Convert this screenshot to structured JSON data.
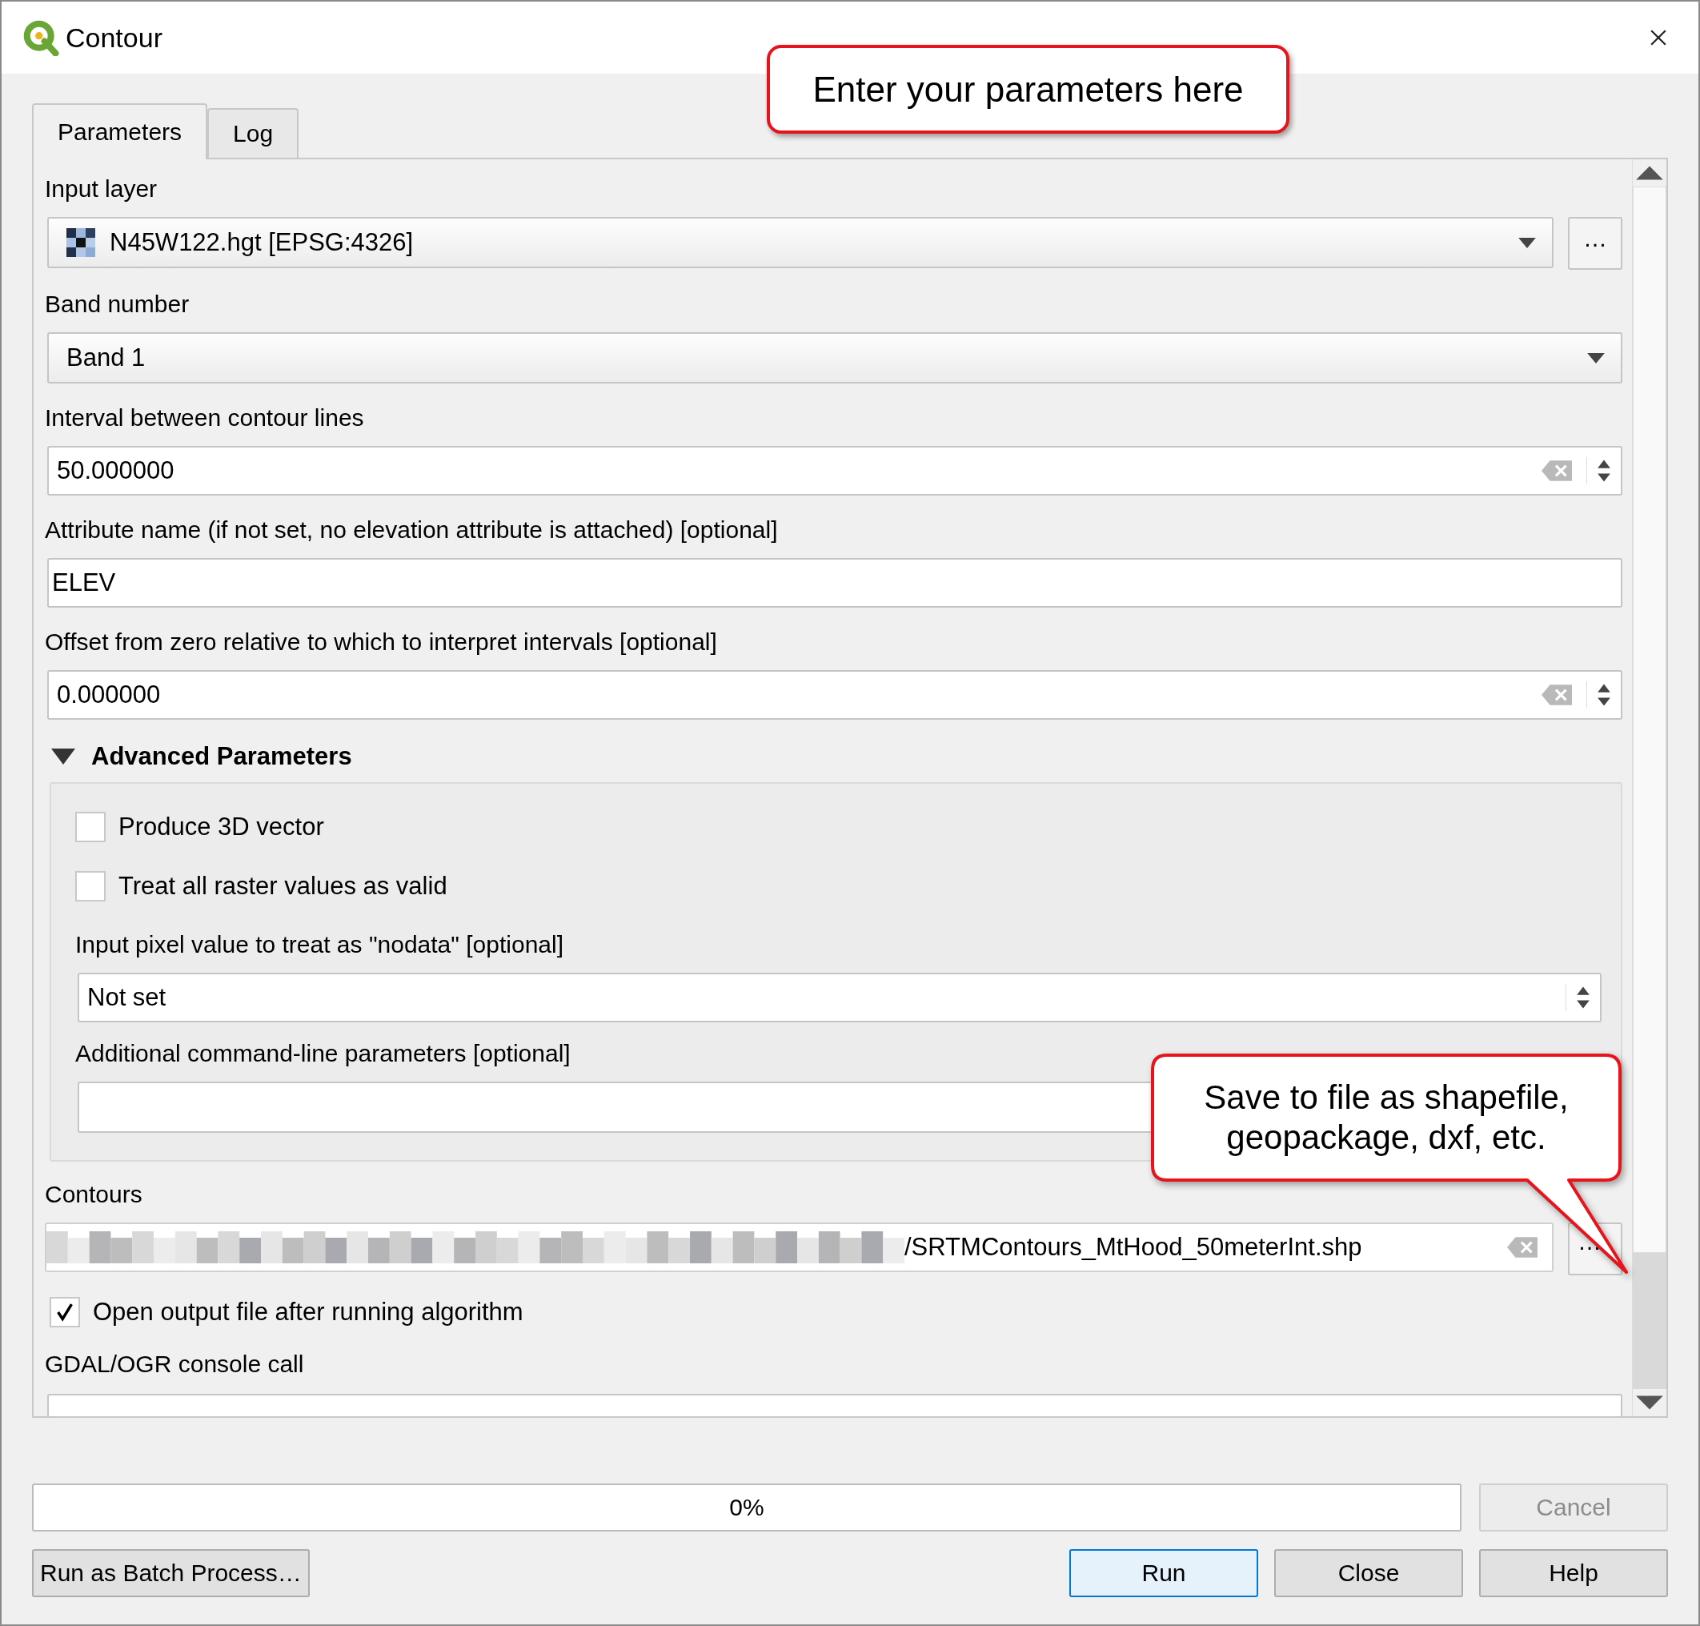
{
  "window": {
    "title": "Contour"
  },
  "tabs": [
    {
      "label": "Parameters",
      "selected": true
    },
    {
      "label": "Log",
      "selected": false
    }
  ],
  "parameters": [
    {
      "kind": "layer",
      "label": "Input layer",
      "value": "N45W122.hgt [EPSG:4326]",
      "browse": "…"
    },
    {
      "kind": "combo",
      "label": "Band number",
      "value": "Band 1"
    },
    {
      "kind": "spin",
      "label": "Interval between contour lines",
      "value": "50.000000",
      "clearable": true
    },
    {
      "kind": "text",
      "label": "Attribute name (if not set, no elevation attribute is attached) [optional]",
      "value": "ELEV"
    },
    {
      "kind": "spin",
      "label": "Offset from zero relative to which to interpret intervals [optional]",
      "value": "0.000000",
      "clearable": true
    }
  ],
  "advanced": {
    "title": "Advanced Parameters",
    "expanded": true,
    "items": [
      {
        "kind": "checkbox",
        "label": "Produce 3D vector",
        "checked": false
      },
      {
        "kind": "checkbox",
        "label": "Treat all raster values as valid",
        "checked": false
      },
      {
        "kind": "spin",
        "label": "Input pixel value to treat as \"nodata\" [optional]",
        "value": "Not set",
        "clearable": false
      },
      {
        "kind": "text",
        "label": "Additional command-line parameters [optional]",
        "value": ""
      }
    ]
  },
  "output": {
    "label": "Contours",
    "value": "/SRTMContours_MtHood_50meterInt.shp",
    "redacted_prefix": true,
    "browse": "…"
  },
  "open_output": {
    "label": "Open output file after running algorithm",
    "checked": true
  },
  "console": {
    "label": "GDAL/OGR console call"
  },
  "progress": {
    "text": "0%",
    "level": 0
  },
  "cancel": {
    "label": "Cancel",
    "disabled": true
  },
  "buttons": [
    {
      "label": "Run as Batch Process…",
      "default": false
    },
    {
      "label": "Run",
      "default": true
    },
    {
      "label": "Close",
      "default": false
    },
    {
      "label": "Help",
      "default": false
    }
  ],
  "callouts": [
    {
      "text": "Enter your parameters here"
    },
    {
      "text": "Save to file as shapefile, geopackage, dxf, etc."
    }
  ]
}
